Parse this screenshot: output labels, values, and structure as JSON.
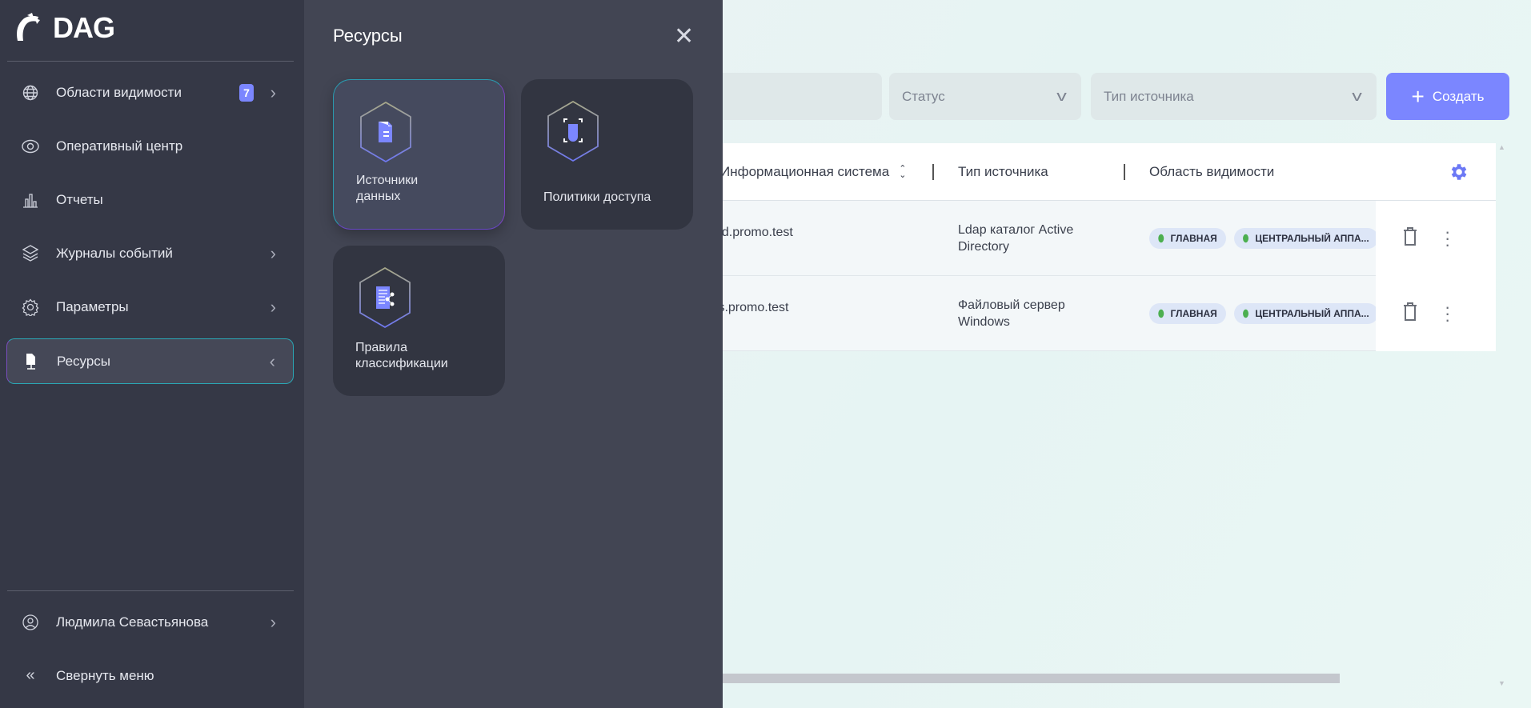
{
  "app": {
    "name": "DAG"
  },
  "sidebar": {
    "items": [
      {
        "label": "Области видимости",
        "icon": "globe-icon",
        "badge": "7",
        "chevron": "›"
      },
      {
        "label": "Оперативный центр",
        "icon": "eye-icon"
      },
      {
        "label": "Отчеты",
        "icon": "bar-chart-icon"
      },
      {
        "label": "Журналы событий",
        "icon": "layers-icon",
        "chevron": "›"
      },
      {
        "label": "Параметры",
        "icon": "gear-icon",
        "chevron": "›"
      },
      {
        "label": "Ресурсы",
        "icon": "resources-icon",
        "chevron": "‹",
        "active": true
      }
    ],
    "user": {
      "name": "Людмила Севастьянова",
      "chevron": "›"
    },
    "collapse": {
      "label": "Свернуть меню",
      "icon": "«"
    }
  },
  "panel": {
    "title": "Ресурсы",
    "close": "✕",
    "cards": [
      {
        "label": "Источники данных",
        "icon": "data-source-icon",
        "selected": true
      },
      {
        "label": "Политики доступа",
        "icon": "access-policy-icon"
      },
      {
        "label": "Правила классификации",
        "icon": "classification-icon"
      }
    ]
  },
  "filters": {
    "status": {
      "placeholder": "Статус"
    },
    "source_type": {
      "placeholder": "Тип источника"
    },
    "create_label": "Создать",
    "create_icon": "+"
  },
  "table": {
    "columns": [
      "Информационная система",
      "Тип источника",
      "Область видимости"
    ],
    "rows": [
      {
        "system": "ad.promo.test",
        "type": "Ldap каталог Active Directory",
        "tags": [
          "ГЛАВНАЯ",
          "ЦЕНТРАЛЬНЫЙ АППА..."
        ]
      },
      {
        "system": "fs.promo.test",
        "type": "Файловый сервер Windows",
        "tags": [
          "ГЛАВНАЯ",
          "ЦЕНТРАЛЬНЫЙ АППА..."
        ]
      }
    ]
  },
  "colors": {
    "accent": "#7b86ff",
    "sidebar": "#353846",
    "panel": "#424553",
    "tag_pin": "#4caf50"
  }
}
